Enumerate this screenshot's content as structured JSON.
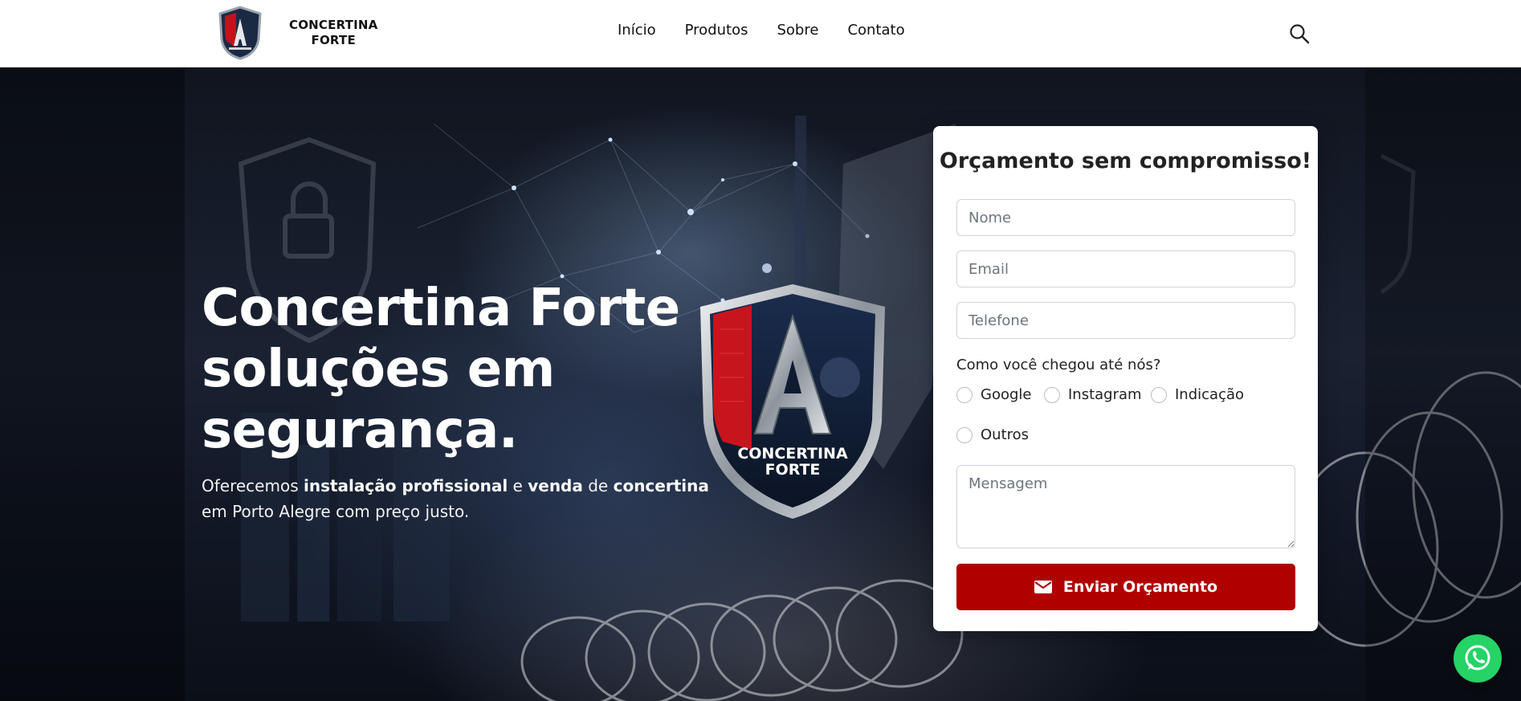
{
  "header": {
    "brand_line1": "CONCERTINA",
    "brand_line2": "FORTE",
    "nav": [
      "Início",
      "Produtos",
      "Sobre",
      "Contato"
    ],
    "search_icon": "search-icon"
  },
  "hero": {
    "title_line1": "Concertina Forte",
    "title_line2": "soluções em",
    "title_line3": "segurança.",
    "sub": {
      "t1": "Oferecemos ",
      "b1": "instalação profissional",
      "t2": " e ",
      "b2": "venda",
      "t3": " de ",
      "b3": "concertina",
      "t4": " em Porto Alegre com preço justo."
    },
    "logo_line1": "CONCERTINA",
    "logo_line2": "FORTE"
  },
  "form": {
    "title": "Orçamento sem compromisso!",
    "nome_placeholder": "Nome",
    "email_placeholder": "Email",
    "telefone_placeholder": "Telefone",
    "source_label": "Como você chegou até nós?",
    "source_options": [
      "Google",
      "Instagram",
      "Indicação",
      "Outros"
    ],
    "mensagem_placeholder": "Mensagem",
    "submit_label": "Enviar Orçamento",
    "submit_icon": "envelope-icon"
  },
  "whatsapp_icon": "whatsapp-icon",
  "colors": {
    "accent_red": "#b00000",
    "whatsapp_green": "#25d366",
    "header_bg": "#ffffff"
  }
}
